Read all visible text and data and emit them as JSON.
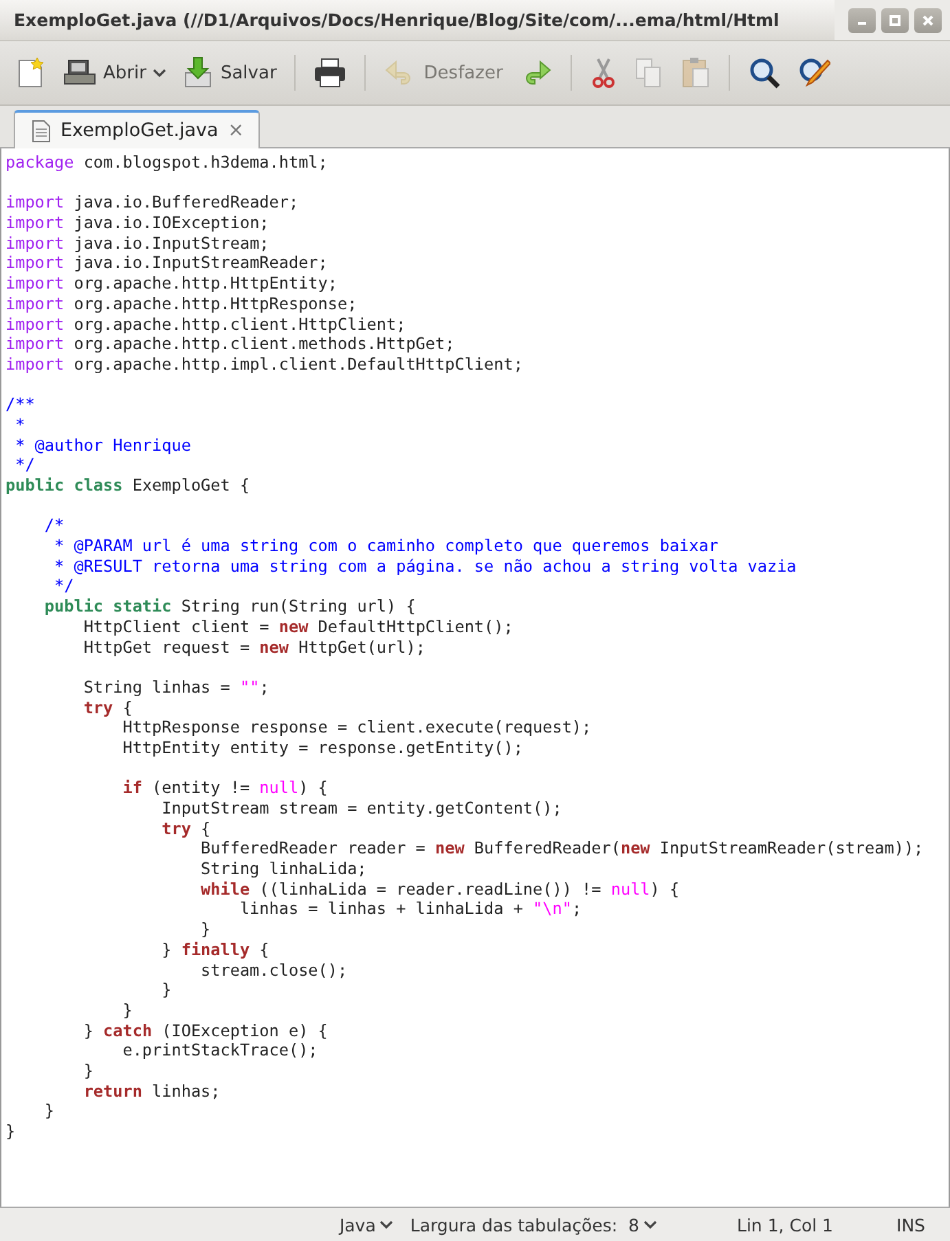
{
  "window": {
    "title": "ExemploGet.java (//D1/Arquivos/Docs/Henrique/Blog/Site/com/...ema/html/Html",
    "controls": [
      {
        "kind": "minimize"
      },
      {
        "kind": "maximize"
      },
      {
        "kind": "close"
      }
    ]
  },
  "toolbar": [
    {
      "kind": "new",
      "disabled": false
    },
    {
      "kind": "open",
      "label": "Abrir",
      "dropdown": true,
      "disabled": false
    },
    {
      "kind": "save",
      "label": "Salvar",
      "disabled": false
    },
    {
      "kind": "separator"
    },
    {
      "kind": "print",
      "disabled": false
    },
    {
      "kind": "separator"
    },
    {
      "kind": "undo",
      "label": "Desfazer",
      "disabled": true
    },
    {
      "kind": "redo",
      "disabled": false
    },
    {
      "kind": "separator"
    },
    {
      "kind": "cut",
      "disabled": false
    },
    {
      "kind": "copy",
      "disabled": true
    },
    {
      "kind": "paste",
      "disabled": true
    },
    {
      "kind": "separator"
    },
    {
      "kind": "find",
      "disabled": false
    },
    {
      "kind": "replace",
      "disabled": false
    }
  ],
  "tabs": [
    {
      "label": "ExemploGet.java",
      "close": "×",
      "selected": true
    }
  ],
  "editor": {
    "lines": [
      {
        "kind": "code",
        "tokens": [
          {
            "kind": "pre",
            "text": "package"
          },
          {
            "kind": "plain",
            "text": " com.blogspot.h3dema.html;"
          }
        ]
      },
      {
        "kind": "blank"
      },
      {
        "kind": "code",
        "tokens": [
          {
            "kind": "pre",
            "text": "import"
          },
          {
            "kind": "plain",
            "text": " java.io.BufferedReader;"
          }
        ]
      },
      {
        "kind": "code",
        "tokens": [
          {
            "kind": "pre",
            "text": "import"
          },
          {
            "kind": "plain",
            "text": " java.io.IOException;"
          }
        ]
      },
      {
        "kind": "code",
        "tokens": [
          {
            "kind": "pre",
            "text": "import"
          },
          {
            "kind": "plain",
            "text": " java.io.InputStream;"
          }
        ]
      },
      {
        "kind": "code",
        "tokens": [
          {
            "kind": "pre",
            "text": "import"
          },
          {
            "kind": "plain",
            "text": " java.io.InputStreamReader;"
          }
        ]
      },
      {
        "kind": "code",
        "tokens": [
          {
            "kind": "pre",
            "text": "import"
          },
          {
            "kind": "plain",
            "text": " org.apache.http.HttpEntity;"
          }
        ]
      },
      {
        "kind": "code",
        "tokens": [
          {
            "kind": "pre",
            "text": "import"
          },
          {
            "kind": "plain",
            "text": " org.apache.http.HttpResponse;"
          }
        ]
      },
      {
        "kind": "code",
        "tokens": [
          {
            "kind": "pre",
            "text": "import"
          },
          {
            "kind": "plain",
            "text": " org.apache.http.client.HttpClient;"
          }
        ]
      },
      {
        "kind": "code",
        "tokens": [
          {
            "kind": "pre",
            "text": "import"
          },
          {
            "kind": "plain",
            "text": " org.apache.http.client.methods.HttpGet;"
          }
        ]
      },
      {
        "kind": "code",
        "tokens": [
          {
            "kind": "pre",
            "text": "import"
          },
          {
            "kind": "plain",
            "text": " org.apache.http.impl.client.DefaultHttpClient;"
          }
        ]
      },
      {
        "kind": "blank"
      },
      {
        "kind": "code",
        "tokens": [
          {
            "kind": "com",
            "text": "/**"
          }
        ]
      },
      {
        "kind": "code",
        "tokens": [
          {
            "kind": "com",
            "text": " *"
          }
        ]
      },
      {
        "kind": "code",
        "tokens": [
          {
            "kind": "com",
            "text": " * @author Henrique"
          }
        ]
      },
      {
        "kind": "code",
        "tokens": [
          {
            "kind": "com",
            "text": " */"
          }
        ]
      },
      {
        "kind": "code",
        "tokens": [
          {
            "kind": "mod",
            "text": "public class"
          },
          {
            "kind": "plain",
            "text": " ExemploGet {"
          }
        ]
      },
      {
        "kind": "blank"
      },
      {
        "kind": "code",
        "tokens": [
          {
            "kind": "com",
            "text": "    /*"
          }
        ]
      },
      {
        "kind": "code",
        "tokens": [
          {
            "kind": "com",
            "text": "     * @PARAM url é uma string com o caminho completo que queremos baixar"
          }
        ]
      },
      {
        "kind": "code",
        "tokens": [
          {
            "kind": "com",
            "text": "     * @RESULT retorna uma string com a página. se não achou a string volta vazia"
          }
        ]
      },
      {
        "kind": "code",
        "tokens": [
          {
            "kind": "com",
            "text": "     */"
          }
        ]
      },
      {
        "kind": "code",
        "tokens": [
          {
            "kind": "mod",
            "text": "    public static"
          },
          {
            "kind": "plain",
            "text": " String run(String url) {"
          }
        ]
      },
      {
        "kind": "code",
        "tokens": [
          {
            "kind": "plain",
            "text": "        HttpClient client = "
          },
          {
            "kind": "kw",
            "text": "new"
          },
          {
            "kind": "plain",
            "text": " DefaultHttpClient();"
          }
        ]
      },
      {
        "kind": "code",
        "tokens": [
          {
            "kind": "plain",
            "text": "        HttpGet request = "
          },
          {
            "kind": "kw",
            "text": "new"
          },
          {
            "kind": "plain",
            "text": " HttpGet(url);"
          }
        ]
      },
      {
        "kind": "blank"
      },
      {
        "kind": "code",
        "tokens": [
          {
            "kind": "plain",
            "text": "        String linhas = "
          },
          {
            "kind": "str",
            "text": "\"\""
          },
          {
            "kind": "plain",
            "text": ";"
          }
        ]
      },
      {
        "kind": "code",
        "tokens": [
          {
            "kind": "kw",
            "text": "        try"
          },
          {
            "kind": "plain",
            "text": " {"
          }
        ]
      },
      {
        "kind": "code",
        "tokens": [
          {
            "kind": "plain",
            "text": "            HttpResponse response = client.execute(request);"
          }
        ]
      },
      {
        "kind": "code",
        "tokens": [
          {
            "kind": "plain",
            "text": "            HttpEntity entity = response.getEntity();"
          }
        ]
      },
      {
        "kind": "blank"
      },
      {
        "kind": "code",
        "tokens": [
          {
            "kind": "kw",
            "text": "            if"
          },
          {
            "kind": "plain",
            "text": " (entity != "
          },
          {
            "kind": "const",
            "text": "null"
          },
          {
            "kind": "plain",
            "text": ") {"
          }
        ]
      },
      {
        "kind": "code",
        "tokens": [
          {
            "kind": "plain",
            "text": "                InputStream stream = entity.getContent();"
          }
        ]
      },
      {
        "kind": "code",
        "tokens": [
          {
            "kind": "kw",
            "text": "                try"
          },
          {
            "kind": "plain",
            "text": " {"
          }
        ]
      },
      {
        "kind": "code",
        "tokens": [
          {
            "kind": "plain",
            "text": "                    BufferedReader reader = "
          },
          {
            "kind": "kw",
            "text": "new"
          },
          {
            "kind": "plain",
            "text": " BufferedReader("
          },
          {
            "kind": "kw",
            "text": "new"
          },
          {
            "kind": "plain",
            "text": " InputStreamReader(stream));"
          }
        ]
      },
      {
        "kind": "code",
        "tokens": [
          {
            "kind": "plain",
            "text": "                    String linhaLida;"
          }
        ]
      },
      {
        "kind": "code",
        "tokens": [
          {
            "kind": "kw",
            "text": "                    while"
          },
          {
            "kind": "plain",
            "text": " ((linhaLida = reader.readLine()) != "
          },
          {
            "kind": "const",
            "text": "null"
          },
          {
            "kind": "plain",
            "text": ") {"
          }
        ]
      },
      {
        "kind": "code",
        "tokens": [
          {
            "kind": "plain",
            "text": "                        linhas = linhas + linhaLida + "
          },
          {
            "kind": "str",
            "text": "\"\\n\""
          },
          {
            "kind": "plain",
            "text": ";"
          }
        ]
      },
      {
        "kind": "code",
        "tokens": [
          {
            "kind": "plain",
            "text": "                    }"
          }
        ]
      },
      {
        "kind": "code",
        "tokens": [
          {
            "kind": "plain",
            "text": "                } "
          },
          {
            "kind": "kw",
            "text": "finally"
          },
          {
            "kind": "plain",
            "text": " {"
          }
        ]
      },
      {
        "kind": "code",
        "tokens": [
          {
            "kind": "plain",
            "text": "                    stream.close();"
          }
        ]
      },
      {
        "kind": "code",
        "tokens": [
          {
            "kind": "plain",
            "text": "                }"
          }
        ]
      },
      {
        "kind": "code",
        "tokens": [
          {
            "kind": "plain",
            "text": "            }"
          }
        ]
      },
      {
        "kind": "code",
        "tokens": [
          {
            "kind": "plain",
            "text": "        } "
          },
          {
            "kind": "kw",
            "text": "catch"
          },
          {
            "kind": "plain",
            "text": " (IOException e) {"
          }
        ]
      },
      {
        "kind": "code",
        "tokens": [
          {
            "kind": "plain",
            "text": "            e.printStackTrace();"
          }
        ]
      },
      {
        "kind": "code",
        "tokens": [
          {
            "kind": "plain",
            "text": "        }"
          }
        ]
      },
      {
        "kind": "code",
        "tokens": [
          {
            "kind": "kw",
            "text": "        return"
          },
          {
            "kind": "plain",
            "text": " linhas;"
          }
        ]
      },
      {
        "kind": "code",
        "tokens": [
          {
            "kind": "plain",
            "text": "    }"
          }
        ]
      },
      {
        "kind": "code",
        "tokens": [
          {
            "kind": "plain",
            "text": "}"
          }
        ]
      }
    ]
  },
  "status_bar": {
    "language": "Java",
    "tab_width": "Largura das tabulações:  8",
    "position": "Lin 1, Col 1",
    "mode": "INS"
  }
}
